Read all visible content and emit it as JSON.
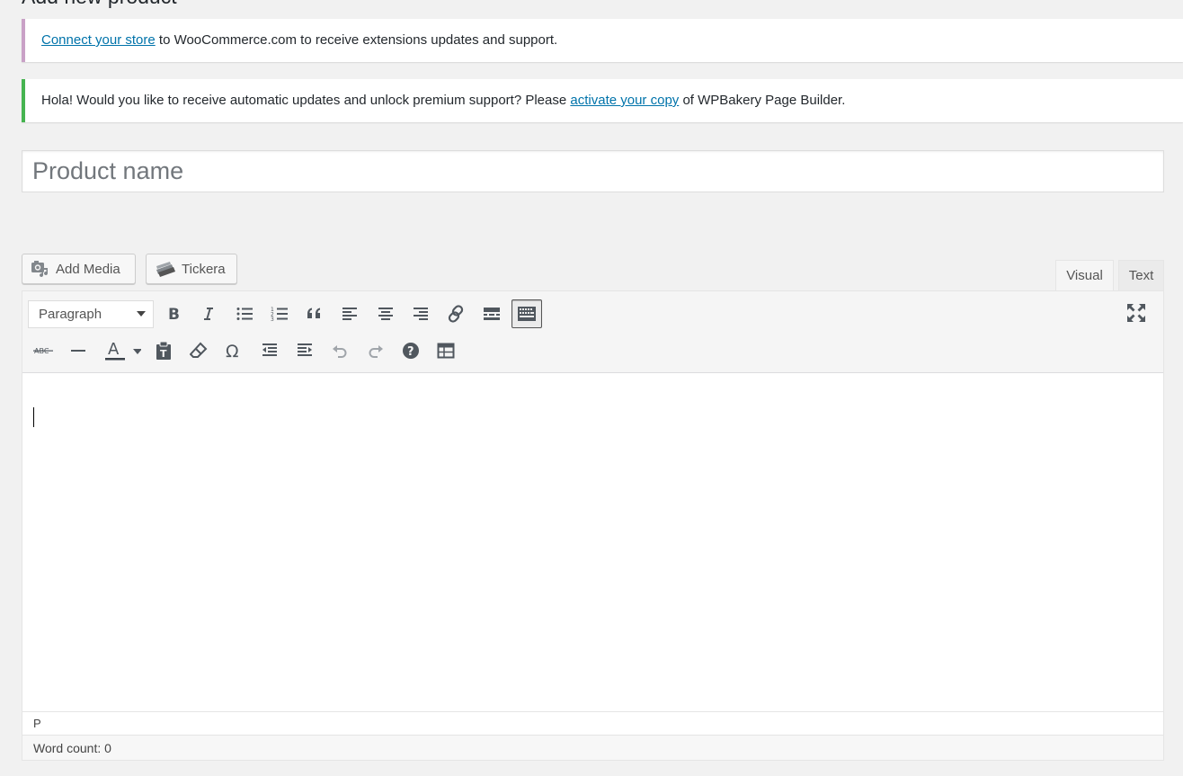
{
  "page": {
    "title": "Add new product"
  },
  "notices": {
    "woo": {
      "link": "Connect your store",
      "text": " to WooCommerce.com to receive extensions updates and support."
    },
    "wpbakery": {
      "before": "Hola! Would you like to receive automatic updates and unlock premium support? Please ",
      "link": "activate your copy",
      "after": " of WPBakery Page Builder."
    }
  },
  "title_field": {
    "placeholder": "Product name",
    "value": ""
  },
  "media_buttons": {
    "add_media": "Add Media",
    "tickera": "Tickera"
  },
  "editor_tabs": {
    "visual": "Visual",
    "text": "Text"
  },
  "toolbar": {
    "format_select": "Paragraph",
    "row1_icons": [
      "bold-icon",
      "italic-icon",
      "bullet-list-icon",
      "numbered-list-icon",
      "blockquote-icon",
      "align-left-icon",
      "align-center-icon",
      "align-right-icon",
      "link-icon",
      "read-more-icon",
      "toolbar-toggle-icon"
    ],
    "row2_icons": [
      "strikethrough-icon",
      "horizontal-line-icon",
      "text-color-icon",
      "paste-text-icon",
      "clear-formatting-icon",
      "special-character-icon",
      "outdent-icon",
      "indent-icon",
      "undo-icon",
      "redo-icon",
      "help-icon",
      "table-icon"
    ],
    "text_color_glyph": "A",
    "strike_glyph": "ABC",
    "omega_glyph": "Ω",
    "help_glyph": "?"
  },
  "statusbar": {
    "path": "P"
  },
  "word_count": "Word count: 0"
}
